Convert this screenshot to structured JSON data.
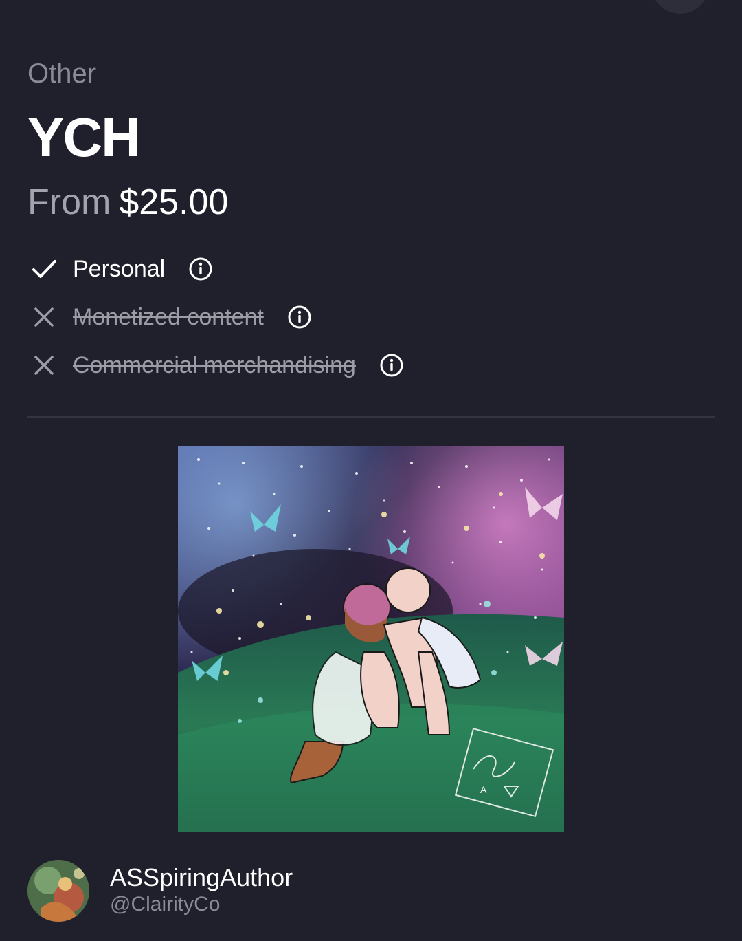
{
  "listing": {
    "category": "Other",
    "title": "YCH",
    "price_prefix": "From",
    "price": "$25.00"
  },
  "usage_rights": [
    {
      "label": "Personal",
      "allowed": true
    },
    {
      "label": "Monetized content",
      "allowed": false
    },
    {
      "label": "Commercial merchandising",
      "allowed": false
    }
  ],
  "artwork": {
    "signature_text": "A"
  },
  "author": {
    "name": "ASSpiringAuthor",
    "handle": "@ClairityCo"
  },
  "colors": {
    "background": "#20202c",
    "muted_text": "#8b8b97",
    "primary_text": "#ffffff"
  },
  "icons": {
    "allowed": "check-icon",
    "disallowed": "close-icon",
    "info": "info-icon"
  }
}
